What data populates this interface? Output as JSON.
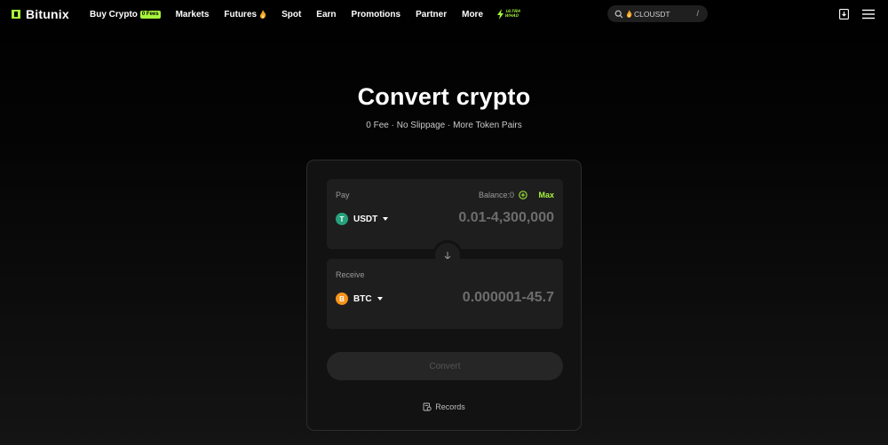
{
  "brand": {
    "name": "Bitunix",
    "accent": "#a6f43b"
  },
  "nav": {
    "items": [
      {
        "label": "Buy Crypto",
        "badge": "0 Fees"
      },
      {
        "label": "Markets"
      },
      {
        "label": "Futures",
        "icon": "fire-icon"
      },
      {
        "label": "Spot"
      },
      {
        "label": "Earn"
      },
      {
        "label": "Promotions"
      },
      {
        "label": "Partner"
      },
      {
        "label": "More"
      }
    ],
    "ultra": {
      "line1": "ULTRA",
      "line2": "WHAD"
    },
    "search": {
      "placeholder": "CLOUSDT",
      "shortcut": "/"
    }
  },
  "hero": {
    "title": "Convert crypto",
    "subtitle": "0 Fee · No Slippage · More Token Pairs"
  },
  "convert": {
    "pay": {
      "label": "Pay",
      "balance": "Balance:0",
      "max": "Max",
      "coin": "USDT",
      "coin_symbol": "T",
      "coin_color": "#26a17b",
      "amount_placeholder": "0.01-4,300,000"
    },
    "receive": {
      "label": "Receive",
      "coin": "BTC",
      "coin_symbol": "B",
      "coin_color": "#f7931a",
      "amount_placeholder": "0.000001-45.7"
    },
    "button": "Convert",
    "records": "Records"
  }
}
